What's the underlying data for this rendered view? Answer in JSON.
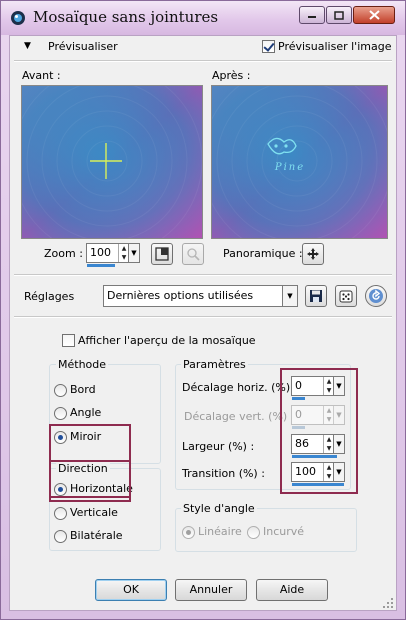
{
  "window": {
    "title": "Mosaïque sans jointures"
  },
  "preview": {
    "toggle_label": "Prévisualiser",
    "checkbox_label": "Prévisualiser l'image",
    "checkbox_checked": true,
    "before_label": "Avant :",
    "after_label": "Après :",
    "watermark": "Pine"
  },
  "zoom": {
    "label": "Zoom :",
    "value": "100",
    "pan_label": "Panoramique :"
  },
  "presets": {
    "label": "Réglages",
    "value": "Dernières options utilisées"
  },
  "tile_preview": {
    "label": "Afficher l'aperçu de la mosaïque",
    "checked": false
  },
  "method": {
    "title": "Méthode",
    "options": [
      {
        "label": "Bord",
        "selected": false
      },
      {
        "label": "Angle",
        "selected": false
      },
      {
        "label": "Miroir",
        "selected": true
      }
    ]
  },
  "direction": {
    "title": "Direction",
    "options": [
      {
        "label": "Horizontale",
        "selected": true
      },
      {
        "label": "Verticale",
        "selected": false
      },
      {
        "label": "Bilatérale",
        "selected": false
      }
    ]
  },
  "params": {
    "title": "Paramètres",
    "fields": [
      {
        "label": "Décalage horiz. (%) :",
        "value": "0",
        "enabled": true,
        "level": 0.25
      },
      {
        "label": "Décalage vert. (%) :",
        "value": "0",
        "enabled": false,
        "level": 0.25
      },
      {
        "label": "Largeur (%) :",
        "value": "86",
        "enabled": true,
        "level": 0.86
      },
      {
        "label": "Transition (%) :",
        "value": "100",
        "enabled": true,
        "level": 1.0
      }
    ]
  },
  "corner_style": {
    "title": "Style d'angle",
    "options": [
      {
        "label": "Linéaire",
        "selected": true
      },
      {
        "label": "Incurvé",
        "selected": false
      }
    ]
  },
  "buttons": {
    "ok": "OK",
    "cancel": "Annuler",
    "help": "Aide"
  },
  "colors": {
    "highlight": "#8e2b4f",
    "accent": "#3a86d0",
    "preview_a": "#2f9ccc",
    "preview_b": "#c056b8"
  }
}
